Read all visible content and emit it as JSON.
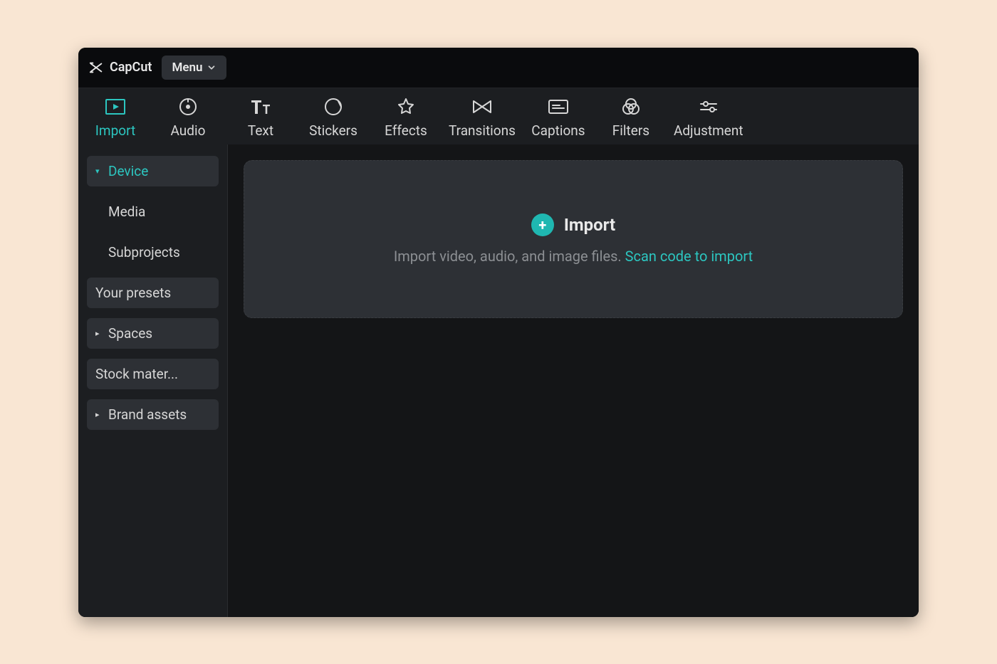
{
  "brand": {
    "name": "CapCut"
  },
  "menu": {
    "label": "Menu"
  },
  "tabs": [
    {
      "key": "import",
      "label": "Import",
      "active": true
    },
    {
      "key": "audio",
      "label": "Audio",
      "active": false
    },
    {
      "key": "text",
      "label": "Text",
      "active": false
    },
    {
      "key": "stickers",
      "label": "Stickers",
      "active": false
    },
    {
      "key": "effects",
      "label": "Effects",
      "active": false
    },
    {
      "key": "transitions",
      "label": "Transitions",
      "active": false
    },
    {
      "key": "captions",
      "label": "Captions",
      "active": false
    },
    {
      "key": "filters",
      "label": "Filters",
      "active": false
    },
    {
      "key": "adjustment",
      "label": "Adjustment",
      "active": false
    }
  ],
  "sidebar": {
    "items": [
      {
        "key": "device",
        "label": "Device",
        "expandable": true,
        "expanded": true,
        "active": true,
        "style": "active"
      },
      {
        "key": "media",
        "label": "Media",
        "expandable": false,
        "expanded": false,
        "active": false,
        "style": "sub"
      },
      {
        "key": "subprojects",
        "label": "Subprojects",
        "expandable": false,
        "expanded": false,
        "active": false,
        "style": "sub"
      },
      {
        "key": "your-presets",
        "label": "Your presets",
        "expandable": false,
        "expanded": false,
        "active": false,
        "style": "boxed"
      },
      {
        "key": "spaces",
        "label": "Spaces",
        "expandable": true,
        "expanded": false,
        "active": false,
        "style": "boxed"
      },
      {
        "key": "stock",
        "label": "Stock mater...",
        "expandable": false,
        "expanded": false,
        "active": false,
        "style": "boxed"
      },
      {
        "key": "brand-assets",
        "label": "Brand assets",
        "expandable": true,
        "expanded": false,
        "active": false,
        "style": "boxed"
      }
    ]
  },
  "import_panel": {
    "title": "Import",
    "subtitle": "Import video, audio, and image files.",
    "scan_link": "Scan code to import"
  },
  "colors": {
    "accent": "#2cc6c0",
    "bg_window": "#0a0b0d",
    "bg_panel": "#1c1e21",
    "bg_content": "#141517",
    "bg_chip": "#2d3035"
  }
}
